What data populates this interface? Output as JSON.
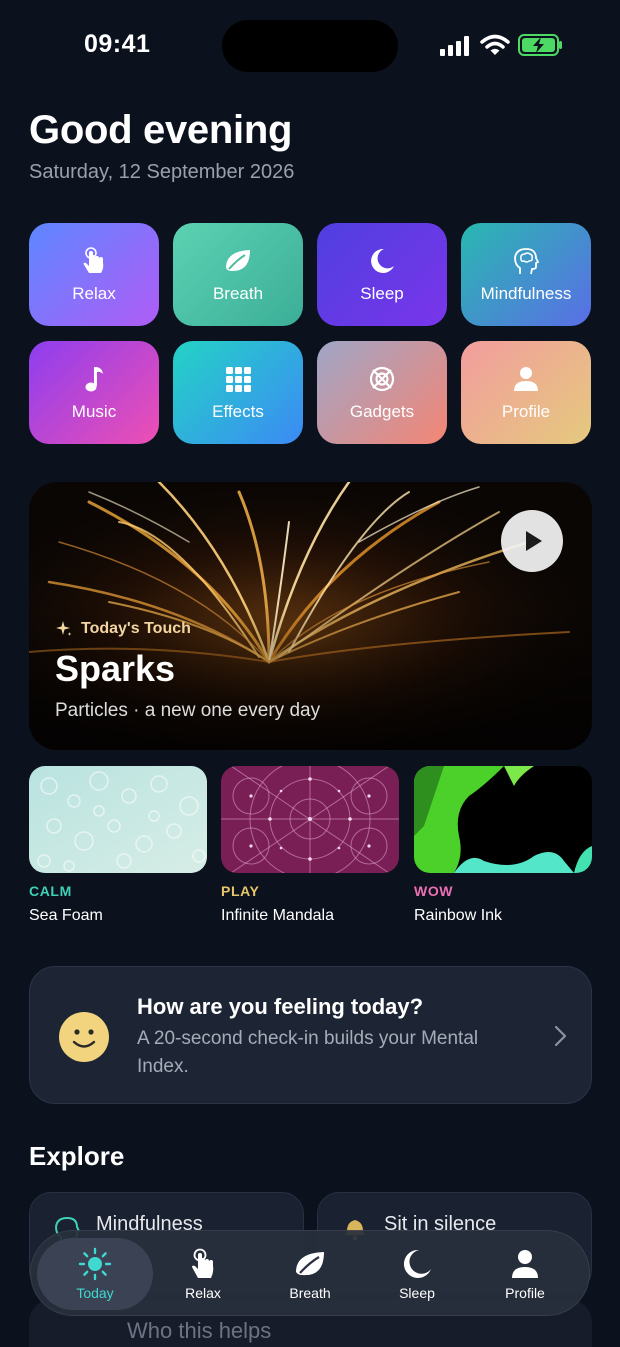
{
  "status_bar": {
    "time": "09:41",
    "icons": [
      "signal-icon",
      "wifi-icon",
      "battery-charging-icon"
    ]
  },
  "header": {
    "greeting": "Good evening",
    "date": "Saturday, 12 September 2026"
  },
  "categories": [
    {
      "label": "Relax",
      "icon": "hand-tap-icon"
    },
    {
      "label": "Breath",
      "icon": "leaf-icon"
    },
    {
      "label": "Sleep",
      "icon": "moon-icon"
    },
    {
      "label": "Mindfulness",
      "icon": "head-brain-icon"
    },
    {
      "label": "Music",
      "icon": "music-note-icon"
    },
    {
      "label": "Effects",
      "icon": "grid-icon"
    },
    {
      "label": "Gadgets",
      "icon": "orbit-icon"
    },
    {
      "label": "Profile",
      "icon": "person-icon"
    }
  ],
  "hero": {
    "eyebrow": "Today's Touch",
    "title": "Sparks",
    "subtitle": "Particles · a new one every day",
    "play_icon": "play-icon"
  },
  "cards": [
    {
      "tag": "CALM",
      "name": "Sea Foam",
      "tag_color": "#3fd0b6"
    },
    {
      "tag": "PLAY",
      "name": "Infinite Mandala",
      "tag_color": "#e7c66a"
    },
    {
      "tag": "WOW",
      "name": "Rainbow Ink",
      "tag_color": "#ef6fb5"
    }
  ],
  "checkin": {
    "title": "How are you feeling today?",
    "text": "A 20-second check-in builds your Mental Index."
  },
  "explore": {
    "heading": "Explore",
    "items": [
      {
        "label": "Mindfulness"
      },
      {
        "label": "Sit in silence"
      },
      {
        "label": "Who this helps"
      }
    ]
  },
  "tabbar": {
    "tabs": [
      {
        "label": "Today",
        "active": true
      },
      {
        "label": "Relax"
      },
      {
        "label": "Breath"
      },
      {
        "label": "Sleep"
      },
      {
        "label": "Profile"
      }
    ],
    "accent": "#3fd9d0"
  }
}
